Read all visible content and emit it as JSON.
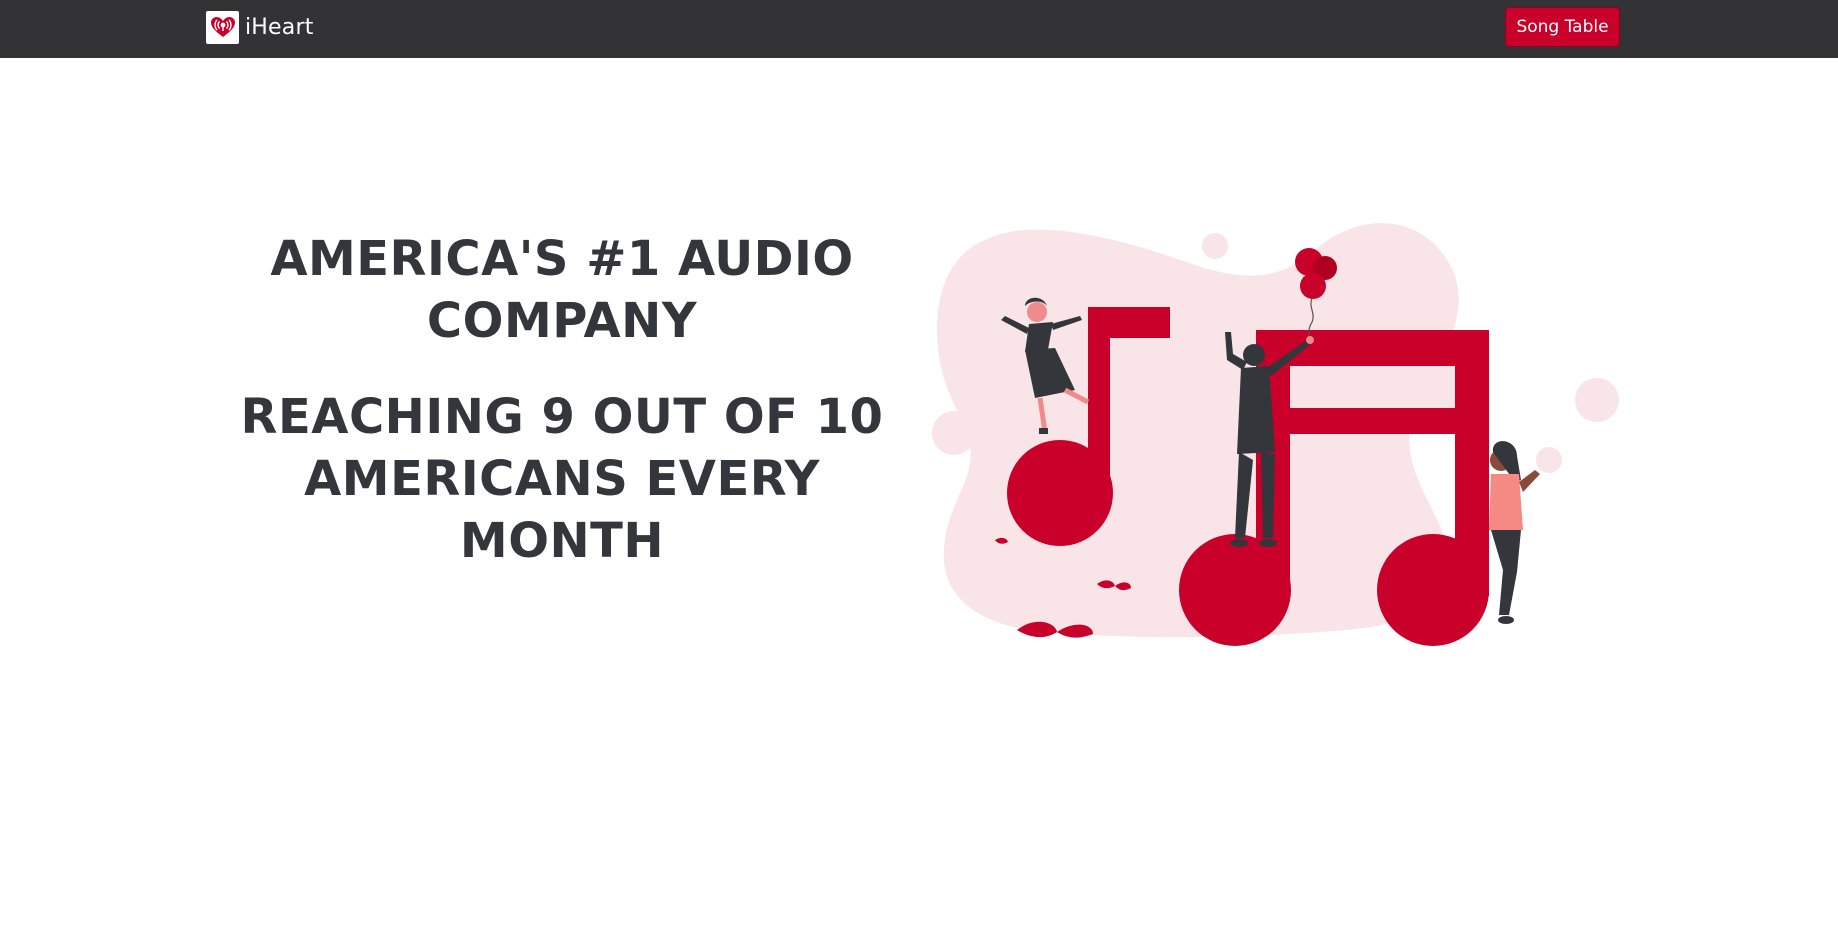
{
  "navbar": {
    "brand_name": "iHeart",
    "logo_icon": "iheart-logo-icon",
    "song_table_button": "Song Table",
    "background_color": "#333336",
    "button_color": "#c8002a"
  },
  "hero": {
    "headline": "AMERICA'S #1 AUDIO COMPANY",
    "subheadline": "REACHING 9 OUT OF 10 AMERICANS EVERY MONTH",
    "text_color": "#33363b"
  },
  "illustration": {
    "icon": "music-notes-people-illustration",
    "accent_color": "#c8002a",
    "blob_color": "#f9e4e8"
  }
}
